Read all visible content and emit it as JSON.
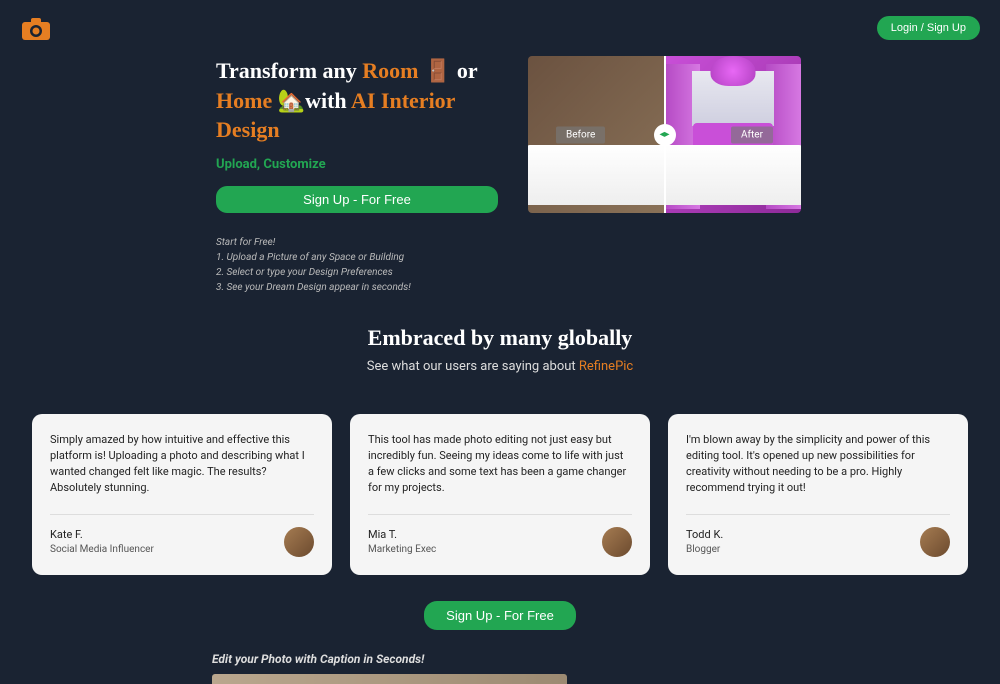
{
  "header": {
    "login_label": "Login / Sign Up"
  },
  "hero": {
    "h1_part1": "Transform any ",
    "h1_room": "Room 🚪",
    "h1_or": " or ",
    "h1_home": "Home 🏡",
    "h1_with": "with ",
    "h1_ai": "AI Interior Design",
    "subheading": "Upload, Customize",
    "signup_label": "Sign Up - For Free",
    "steps_title": "Start for Free!",
    "step1": "1. Upload a Picture of any Space or Building",
    "step2": "2. Select or type your Design Preferences",
    "step3": "3. See your Dream Design appear in seconds!",
    "before_label": "Before",
    "after_label": "After"
  },
  "social": {
    "title": "Embraced by many globally",
    "sub_prefix": "See what our users are saying about ",
    "brand": "RefinePic"
  },
  "testimonials": [
    {
      "text": "Simply amazed by how intuitive and effective this platform is! Uploading a photo and describing what I wanted changed felt like magic. The results? Absolutely stunning.",
      "name": "Kate F.",
      "role": "Social Media Influencer"
    },
    {
      "text": "This tool has made photo editing not just easy but incredibly fun. Seeing my ideas come to life with just a few clicks and some text has been a game changer for my projects.",
      "name": "Mia T.",
      "role": "Marketing Exec"
    },
    {
      "text": "I'm blown away by the simplicity and power of this editing tool. It's opened up new possibilities for creativity without needing to be a pro. Highly recommend trying it out!",
      "name": "Todd K.",
      "role": "Blogger"
    }
  ],
  "signup_mid_label": "Sign Up - For Free",
  "edit_section_title": "Edit your Photo with Caption in Seconds!"
}
